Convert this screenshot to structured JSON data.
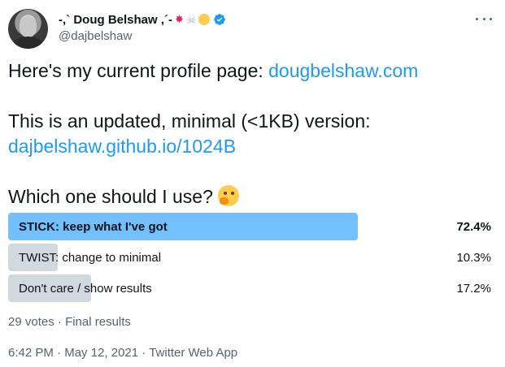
{
  "author": {
    "display_name": "-,` Doug Belshaw ,´-",
    "handle": "@dajbelshaw",
    "name_emojis": [
      "collision-emoji",
      "skull-crossbones-emoji",
      "raised-fist-emoji"
    ],
    "verified": true
  },
  "tweet": {
    "line1_text": "Here's my current profile page: ",
    "line1_link": "dougbelshaw.com",
    "line2_text": "This is an updated, minimal (<1KB) version:",
    "line3_link": "dajbelshaw.github.io/1024B",
    "line4_text": "Which one should I use?",
    "line4_emoji": "thinking-face-emoji"
  },
  "poll": {
    "options": [
      {
        "label": "STICK: keep what I've got",
        "percent": "72.4%",
        "fraction": 0.724,
        "winner": true
      },
      {
        "label": "TWIST: change to minimal",
        "percent": "10.3%",
        "fraction": 0.103,
        "winner": false
      },
      {
        "label": "Don't care / show results",
        "percent": "17.2%",
        "fraction": 0.172,
        "winner": false
      }
    ],
    "votes": "29 votes",
    "status": "Final results",
    "separator": "·"
  },
  "meta": {
    "time": "6:42 PM",
    "date": "May 12, 2021",
    "source": "Twitter Web App",
    "separator": "·"
  },
  "colors": {
    "link": "#1d9bf0",
    "winner_bar": "#72c0ff",
    "other_bar": "#cfd9de",
    "secondary_text": "#536471"
  }
}
